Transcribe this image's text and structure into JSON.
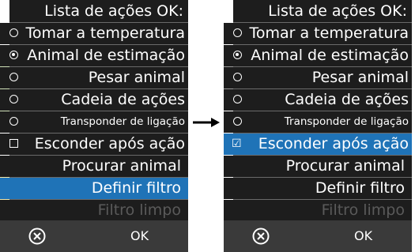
{
  "left": {
    "header": "Lista de ações OK:",
    "items": [
      {
        "label": "Tomar a temperatura"
      },
      {
        "label": "Animal de estimação"
      },
      {
        "label": "Pesar animal"
      },
      {
        "label": "Cadeia de ações"
      },
      {
        "label": "Transponder de ligação"
      },
      {
        "label": "Esconder após ação"
      },
      {
        "label": "Procurar animal"
      },
      {
        "label": "Definir filtro"
      },
      {
        "label": "Filtro limpo"
      }
    ],
    "footer": {
      "ok": "OK"
    }
  },
  "right": {
    "header": "Lista de ações OK:",
    "items": [
      {
        "label": "Tomar a temperatura"
      },
      {
        "label": "Animal de estimação"
      },
      {
        "label": "Pesar animal"
      },
      {
        "label": "Cadeia de ações"
      },
      {
        "label": "Transponder de ligação"
      },
      {
        "label": "Esconder após ação"
      },
      {
        "label": "Procurar animal"
      },
      {
        "label": "Definir filtro"
      },
      {
        "label": "Filtro limpo"
      }
    ],
    "footer": {
      "ok": "OK"
    }
  },
  "colors": {
    "selected": "#1f73b7",
    "panel": "#1d1d1d",
    "footer": "#3a3a3a",
    "disabled_text": "#5a5a5a"
  },
  "icons": {
    "cancel": "circle-x-icon",
    "arrow": "right-arrow-icon"
  }
}
